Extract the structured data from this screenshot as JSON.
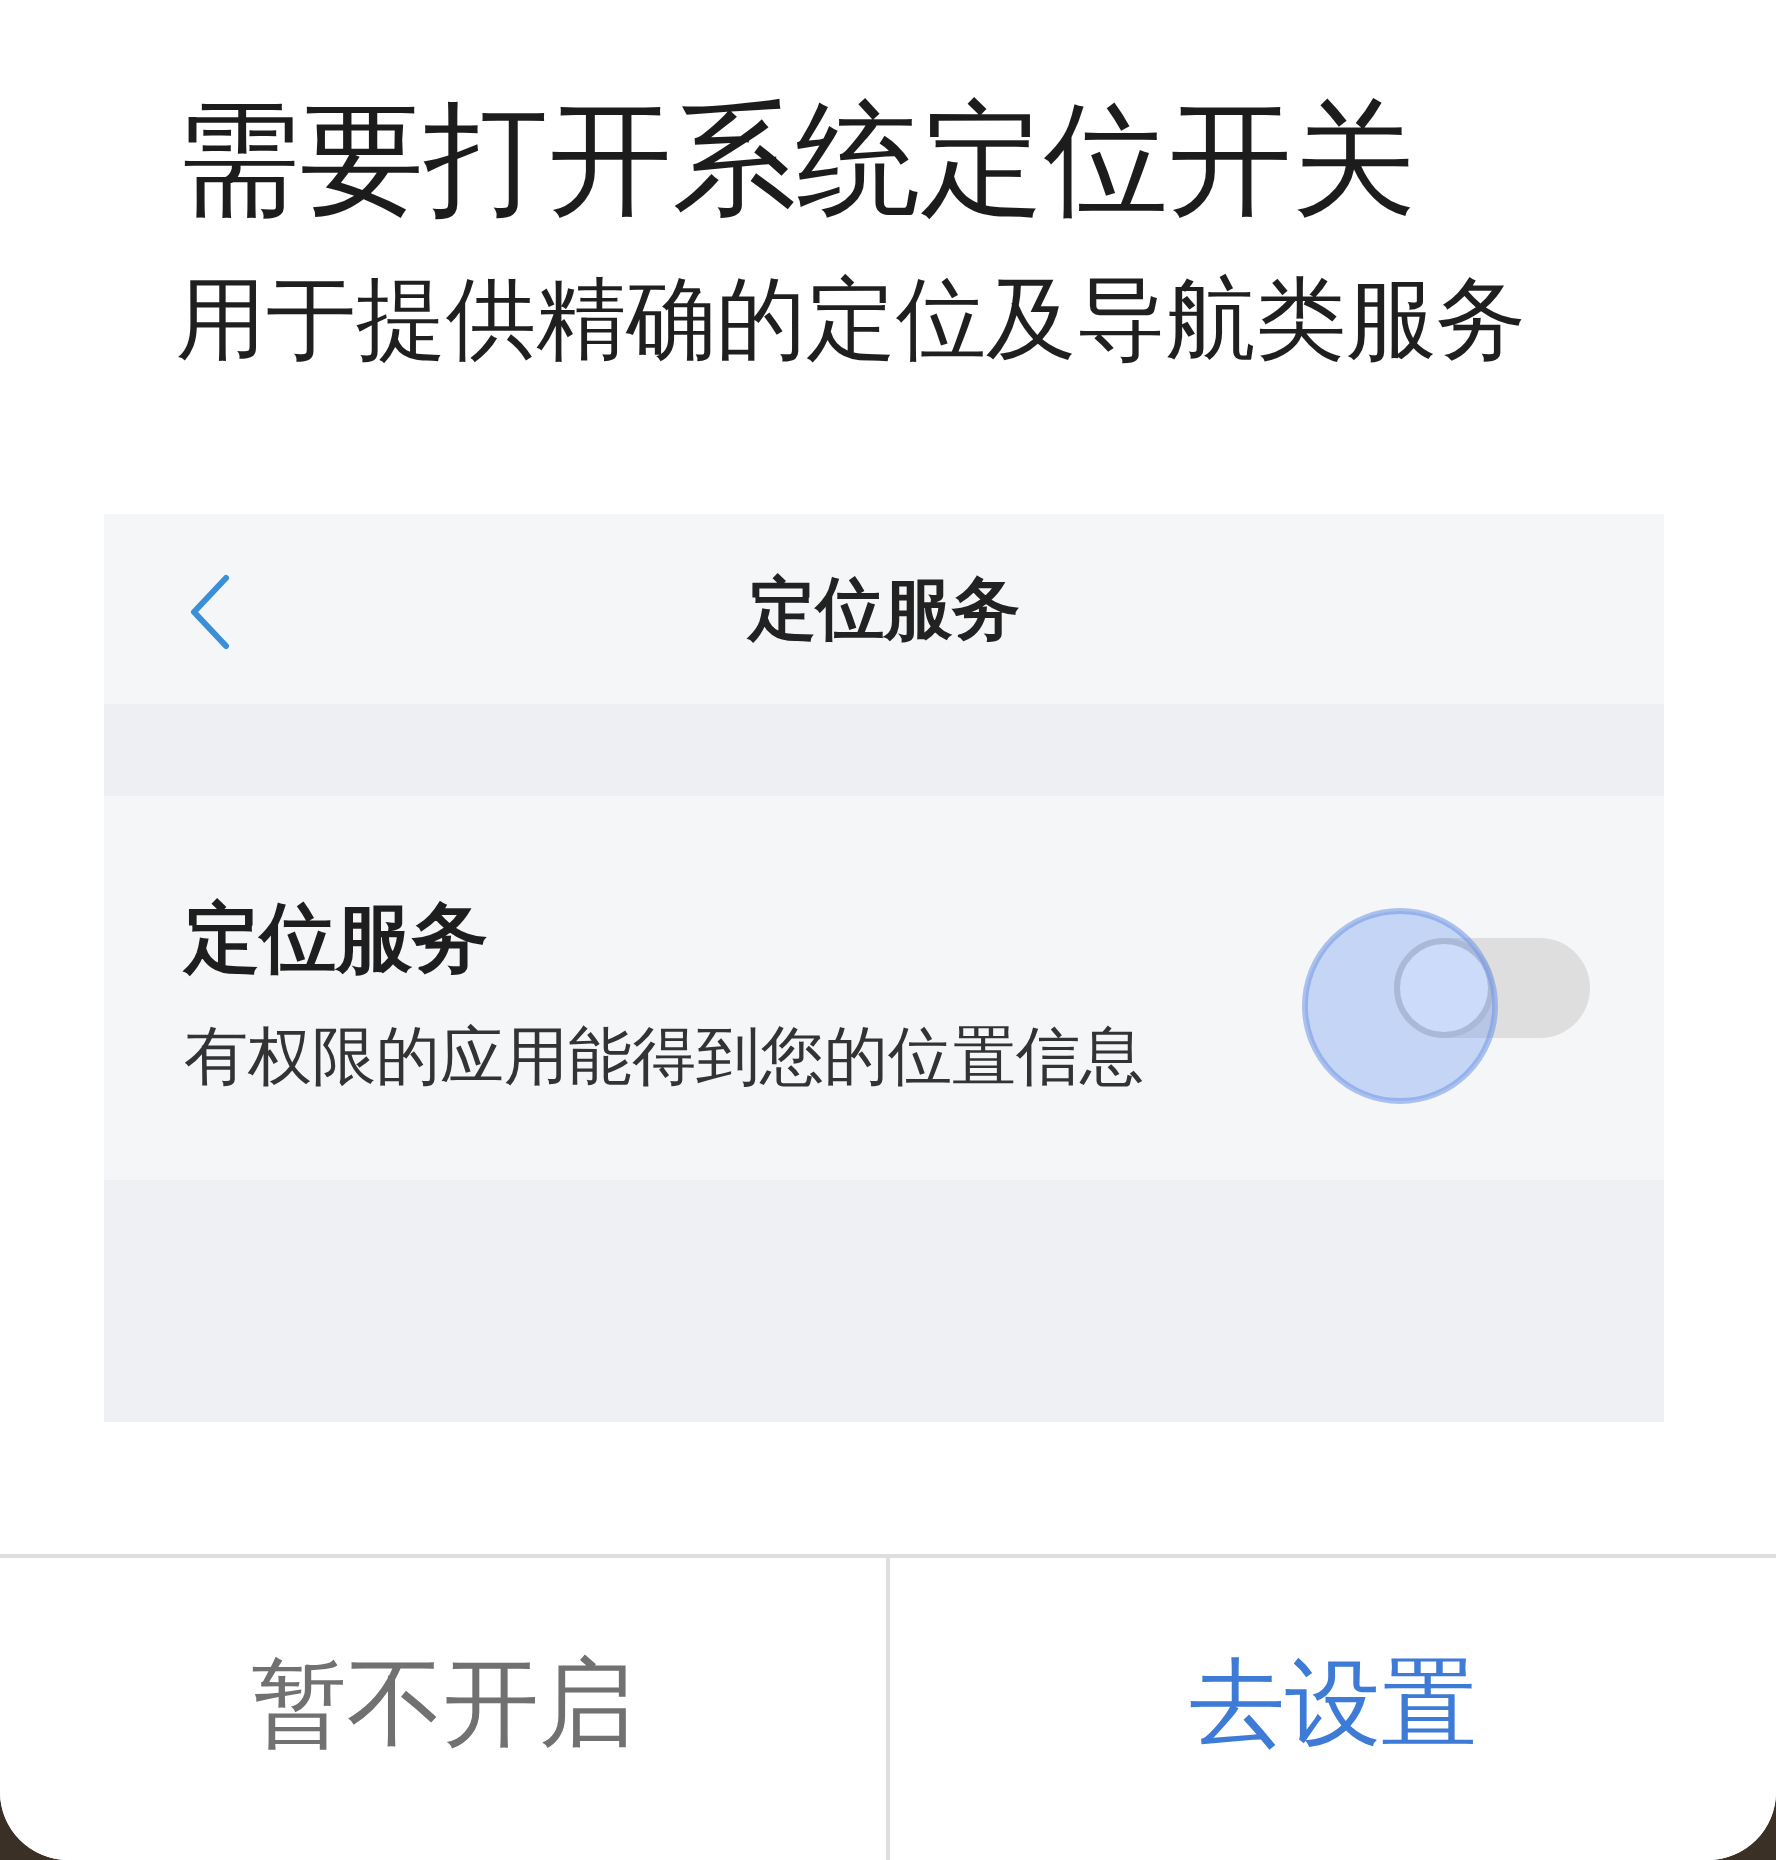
{
  "dialog": {
    "title": "需要打开系统定位开关",
    "subtitle": "用于提供精确的定位及导航类服务"
  },
  "illustration": {
    "header": {
      "title": "定位服务"
    },
    "setting": {
      "label": "定位服务",
      "description": "有权限的应用能得到您的位置信息",
      "toggle": {
        "on": false,
        "touch_highlight": true
      }
    }
  },
  "buttons": [
    {
      "label": "暂不开启",
      "kind": "secondary"
    },
    {
      "label": "去设置",
      "kind": "primary"
    }
  ]
}
